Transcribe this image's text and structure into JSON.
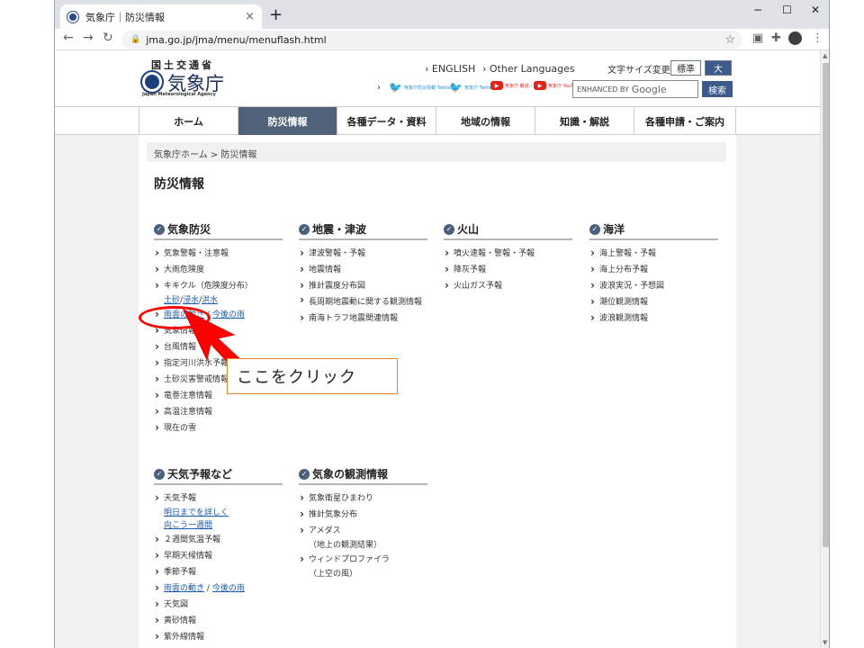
{
  "browser": {
    "tab_title": "気象庁｜防災情報",
    "url": "jma.go.jp/jma/menu/menuflash.html",
    "new_tab": "+",
    "tab_close": "×",
    "win_min": "−",
    "win_max": "☐",
    "win_close": "✕"
  },
  "header": {
    "logo_small": "国土交通省",
    "logo_big": "気象庁",
    "logo_en": "Japan Meteorological Agency",
    "lang_english": "› ENGLISH",
    "lang_other": "› Other Languages",
    "font_size_label": "文字サイズ変更",
    "font_standard": "標準",
    "font_large": "大",
    "sns_arrow": "›",
    "sns_1": "気象庁防災情報 Twitter",
    "sns_2": "気象庁 Twitter",
    "sns_3": "気象庁 報道・解説",
    "sns_4": "気象庁 YouTube",
    "search_prefix": "ENHANCED BY",
    "search_brand": "Google",
    "search_button": "検索"
  },
  "nav": {
    "items": [
      "ホーム",
      "防災情報",
      "各種データ・資料",
      "地域の情報",
      "知識・解説",
      "各種申請・ご案内"
    ],
    "active_index": 1
  },
  "breadcrumb": "気象庁ホーム > 防災情報",
  "page_title": "防災情報",
  "categories": {
    "weather_disaster": {
      "title": "気象防災",
      "items": [
        "気象警報・注意報",
        "大雨危険度",
        "キキクル（危険度分布）",
        "雨雲の動き",
        "気象情報",
        "台風情報",
        "指定河川洪水予報",
        "土砂災害警戒情報",
        "竜巻注意情報",
        "高温注意情報",
        "現在の雪"
      ],
      "kikikuru_sub": [
        "土砂",
        "浸水",
        "洪水"
      ],
      "rain_sub": "今後の雨"
    },
    "earthquake": {
      "title": "地震・津波",
      "items": [
        "津波警報・予報",
        "地震情報",
        "推計震度分布図",
        "長周期地震動に関する観測情報",
        "南海トラフ地震関連情報"
      ]
    },
    "volcano": {
      "title": "火山",
      "items": [
        "噴火速報・警報・予報",
        "降灰予報",
        "火山ガス予報"
      ]
    },
    "ocean": {
      "title": "海洋",
      "items": [
        "海上警報・予報",
        "海上分布予報",
        "波浪実況・予想図",
        "潮位観測情報",
        "波浪観測情報"
      ]
    },
    "forecast": {
      "title": "天気予報など",
      "items": [
        "天気予報",
        "２週間気温予報",
        "早期天候情報",
        "季節予報",
        "雨雲の動き",
        "天気図",
        "黄砂情報",
        "紫外線情報"
      ],
      "forecast_sub": [
        "明日までを詳しく",
        "向こう一週間"
      ],
      "rain_sub": "今後の雨"
    },
    "observation": {
      "title": "気象の観測情報",
      "items": [
        "気象衛星ひまわり",
        "推計気象分布",
        "アメダス",
        "ウィンドプロファイラ"
      ],
      "amedas_sub": "（地上の観測結果）",
      "wind_sub": "（上空の風）"
    }
  },
  "annotation": {
    "label": "ここをクリック",
    "color": "#ff0000"
  },
  "sep": "/"
}
